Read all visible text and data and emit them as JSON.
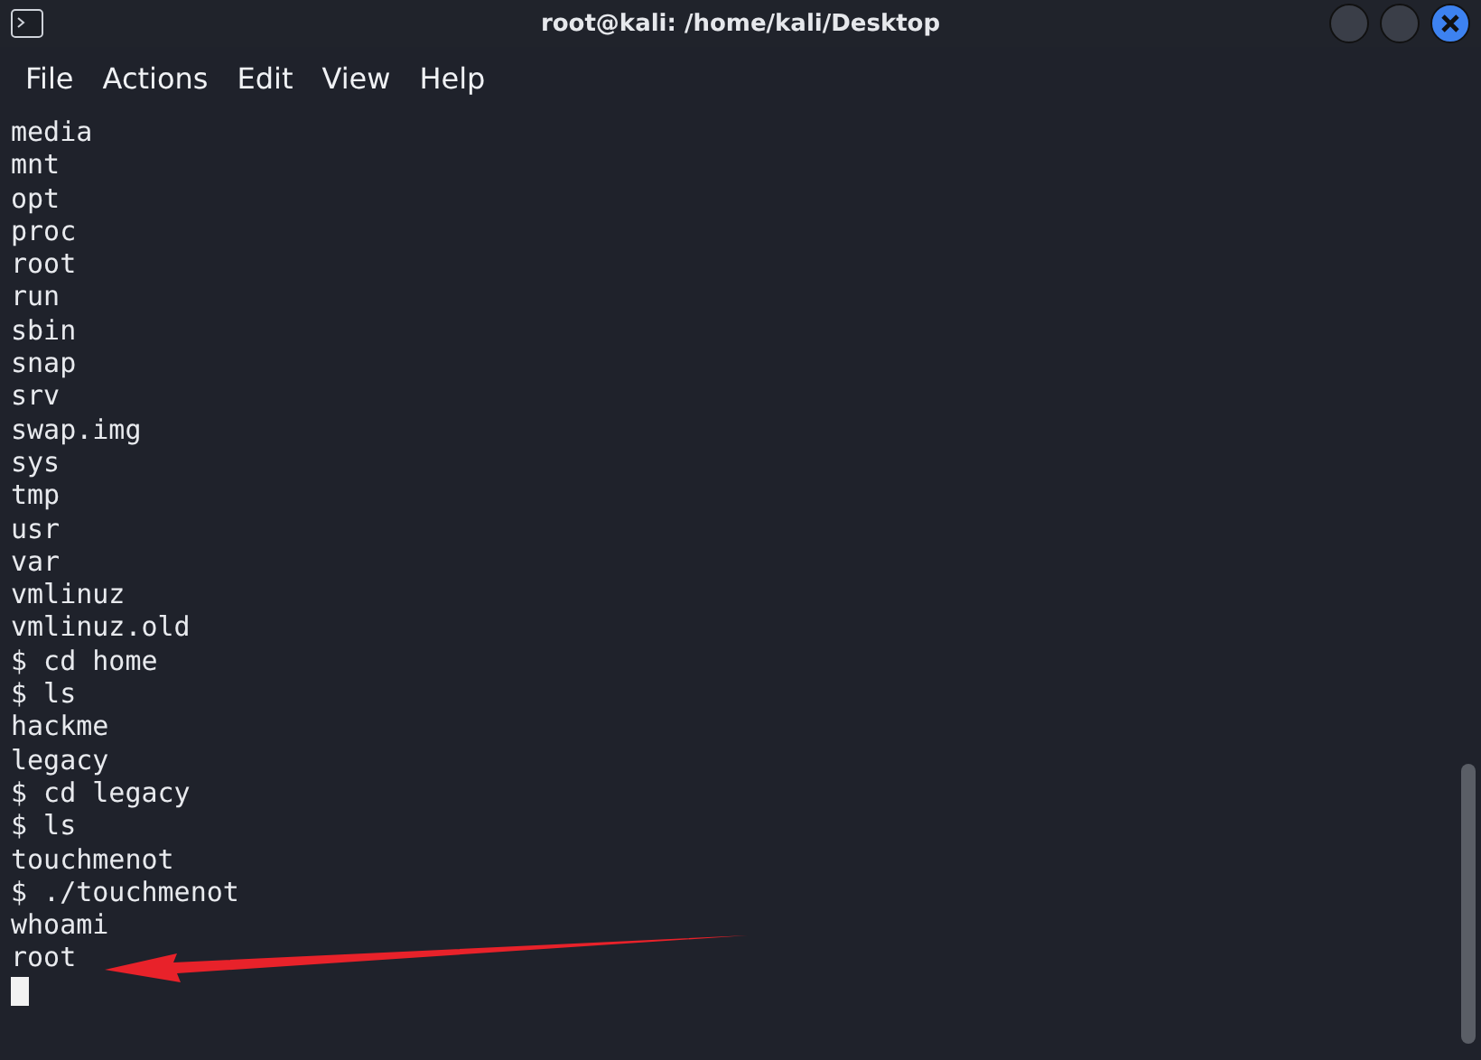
{
  "window": {
    "title": "root@kali: /home/kali/Desktop"
  },
  "menu": [
    "File",
    "Actions",
    "Edit",
    "View",
    "Help"
  ],
  "terminal": {
    "lines": [
      "media",
      "mnt",
      "opt",
      "proc",
      "root",
      "run",
      "sbin",
      "snap",
      "srv",
      "swap.img",
      "sys",
      "tmp",
      "usr",
      "var",
      "vmlinuz",
      "vmlinuz.old",
      "$ cd home",
      "$ ls",
      "hackme",
      "legacy",
      "$ cd legacy",
      "$ ls",
      "touchmenot",
      "$ ./touchmenot",
      "whoami",
      "root"
    ],
    "cursor": true
  },
  "annotation": {
    "kind": "arrow"
  }
}
